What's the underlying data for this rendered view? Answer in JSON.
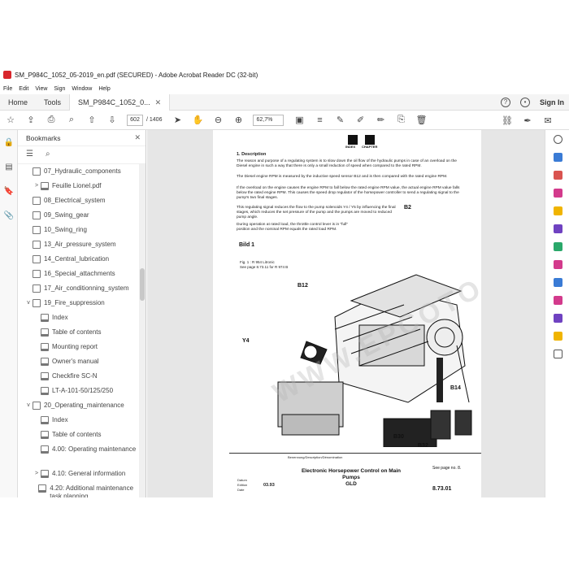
{
  "window": {
    "title": "SM_P984C_1052_05-2019_en.pdf (SECURED) - Adobe Acrobat Reader DC (32-bit)"
  },
  "menu": [
    "File",
    "Edit",
    "View",
    "Sign",
    "Window",
    "Help"
  ],
  "tabs": {
    "home": "Home",
    "tools": "Tools",
    "document": "SM_P984C_1052_0..."
  },
  "account": {
    "signin": "Sign In"
  },
  "toolbar": {
    "page_current": "602",
    "page_total": "/ 1406",
    "zoom": "62,7%"
  },
  "bookmarks": {
    "title": "Bookmarks",
    "items": [
      {
        "label": "07_Hydraulic_components",
        "chev": "",
        "indent": 0
      },
      {
        "label": "Feuille Lionel.pdf",
        "chev": ">",
        "indent": 1
      },
      {
        "label": "08_Electrical_system",
        "chev": "",
        "indent": 0
      },
      {
        "label": "09_Swing_gear",
        "chev": "",
        "indent": 0
      },
      {
        "label": "10_Swing_ring",
        "chev": "",
        "indent": 0
      },
      {
        "label": "13_Air_pressure_system",
        "chev": "",
        "indent": 0
      },
      {
        "label": "14_Central_lubrication",
        "chev": "",
        "indent": 0
      },
      {
        "label": "16_Special_attachments",
        "chev": "",
        "indent": 0
      },
      {
        "label": "17_Air_conditionning_system",
        "chev": "",
        "indent": 0
      },
      {
        "label": "19_Fire_suppression",
        "chev": "v",
        "indent": 0
      },
      {
        "label": "Index",
        "chev": "",
        "indent": 1
      },
      {
        "label": "Table of contents",
        "chev": "",
        "indent": 1
      },
      {
        "label": "Mounting report",
        "chev": "",
        "indent": 1
      },
      {
        "label": "Owner's manual",
        "chev": "",
        "indent": 1
      },
      {
        "label": "Checkfire SC-N",
        "chev": "",
        "indent": 1
      },
      {
        "label": "LT-A-101-50/125/250",
        "chev": "",
        "indent": 1
      },
      {
        "label": "20_Operating_maintenance",
        "chev": "v",
        "indent": 0
      },
      {
        "label": "Index",
        "chev": "",
        "indent": 1
      },
      {
        "label": "Table of contents",
        "chev": "",
        "indent": 1
      },
      {
        "label": "4.00: Operating maintenance",
        "chev": "",
        "indent": 1
      },
      {
        "label": "4.10: General information",
        "chev": ">",
        "indent": 1
      },
      {
        "label": "4.20: Additional maintenance task planning",
        "chev": "",
        "indent": 1
      }
    ]
  },
  "pdf": {
    "nav_index": "INDEX",
    "nav_chapter": "CHAPTER",
    "heading": "1.  Description",
    "para1": "The reason and purpose of a regulating system is to slow down the oil flow of the hydraulic pumps in case of an overload on the Diesel engine in such a way that there is only a small reduction of speed when compared to the rated RPM.",
    "para2": "The Diesel engine RPM is measured by the inductive speed sensor B12 and is then compared with the rated engine RPM.",
    "para3": "If the overload on the engine causes the engine RPM to fall below the rated engine RPM value, the actual engine RPM value falls below the rated engine RPM. This causes the speed drop regulator of the horsepower controller to send a regulating signal to the pump's two final stages.",
    "para4": "This regulating signal reduces the flow to the pump solenoids Y4 / Y5 by influencing the final stages, which reduces the set pressure of the pump and the pumps are moved to reduced pump angle.",
    "para5": "During operation at rated load, the throttle control lever is in \"full\" position and the nominal RPM equals the rated load RPM.",
    "bild": "Bild 1",
    "fig_caption": "Fig. 1 : R 954 Litronic",
    "fig_see": "See page 8.73.11 for R 974 B",
    "labels": {
      "b2": "B2",
      "b12": "B12",
      "y4": "Y4",
      "b14": "B14",
      "b30": "B30",
      "b32": "B32"
    },
    "watermark": "WWW.EPCOTO",
    "title_header": "Benennung/Description/Dénomination",
    "title_main": "Electronic Horsepower Control on Main Pumps",
    "title_sub": "GLD",
    "datum_label": "Datum",
    "edition_label": "Edition",
    "date_label": "Date",
    "date_value": "03.93",
    "see_page": "See page no. 8.",
    "sheet_number": "8.73.01"
  }
}
